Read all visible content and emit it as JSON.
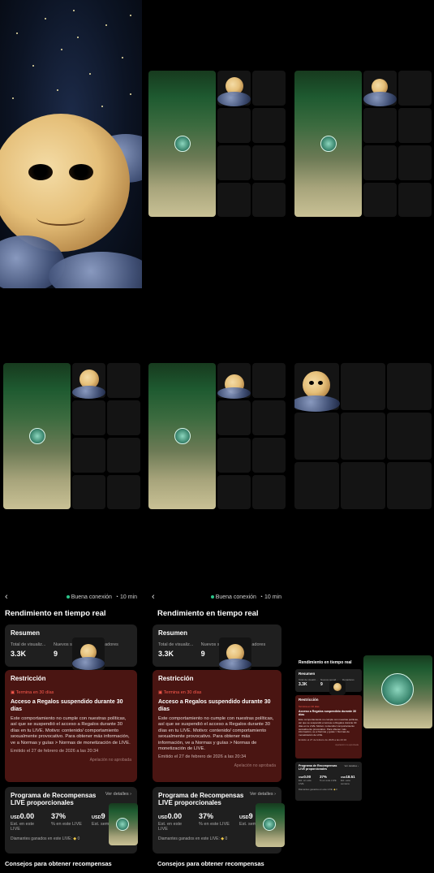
{
  "dashboard": {
    "back_icon": "chevron-left-icon",
    "connection": "Buena conexión",
    "duration": "10 min",
    "title": "Rendimiento en tiempo real",
    "summary": {
      "heading": "Resumen",
      "stats": [
        {
          "label": "Total de visualiz...",
          "value": "3.3K"
        },
        {
          "label": "Nuevos segudor...",
          "value": "9"
        },
        {
          "label": "Donadores",
          "value": "0"
        }
      ]
    },
    "restriction": {
      "heading": "Restricción",
      "badge": "Termina en 30 días",
      "title": "Acceso a Regalos suspendido durante 30 días",
      "body": "Este comportamiento no cumple con nuestras políticas, así que se suspendió el acceso a Regalos durante 30 días en tu LIVE. Motivo: contenido/ comportamiento sexualmente provocativo. Para obtener más información, ve a Normas y guías > Normas de monetización de LIVE.",
      "issued": "Emitido el 27 de febrero de 2026 a las 20:34",
      "appeal": "Apelación no aprobada"
    },
    "rewards": {
      "heading": "Programa de Recompensas LIVE proporcionales",
      "details": "Ver detalles",
      "stats": [
        {
          "currency": "USD",
          "value": "0.00",
          "label": "Est. en este LIVE"
        },
        {
          "currency": "",
          "value": "37%",
          "label": "% en este LIVE"
        },
        {
          "currency": "USD",
          "value": "9",
          "label": "Est. semana"
        }
      ],
      "diamonds": "Diamantes ganados en este LIVE:",
      "diamonds_value": "0"
    },
    "tips": "Consejos para obtener recompensas"
  },
  "mini_dashboard": {
    "title": "Rendimiento en tiempo real",
    "summary_heading": "Resumen",
    "stats": [
      {
        "label": "Total de visualiz...",
        "value": "3.3K"
      },
      {
        "label": "Nuevos segud...",
        "value": "9"
      },
      {
        "label": "Donadores",
        "value": "0"
      }
    ],
    "restriction_heading": "Restricción",
    "badge": "Termina en 30 días",
    "restriction_title": "Acceso a Regalos suspendido durante 30 días",
    "restriction_body": "Este comportamiento no cumple con nuestras políticas, así que se suspendió el acceso a Regalos durante 30 días en tu LIVE. Motivo: contenido/ comportamiento sexualmente provocativo. Para obtener más información, ve a Normas y guías > Normas de monetización de LIVE.",
    "issued": "Emitido el 27 de febrero de 2026 a las 20:34",
    "appeal": "Apelación no aprobada",
    "rewards_heading": "Programa de Recompensas LIVE proporcionales",
    "details": "Ver detalles",
    "reward_stats": [
      {
        "currency": "USD",
        "value": "0.00",
        "label": "Est. en este LIVE"
      },
      {
        "currency": "",
        "value": "37%",
        "label": "% en este LIVE"
      },
      {
        "currency": "USD",
        "value": "18.51",
        "label": "Est. esta semana"
      }
    ],
    "diamonds": "Diamantes ganados en este LIVE:",
    "diamonds_value": "0"
  },
  "colors": {
    "accent_green": "#2cc58a",
    "restriction_bg": "#4a1512",
    "restriction_badge": "#ff5b4f",
    "card_bg": "#1f1f1f"
  }
}
